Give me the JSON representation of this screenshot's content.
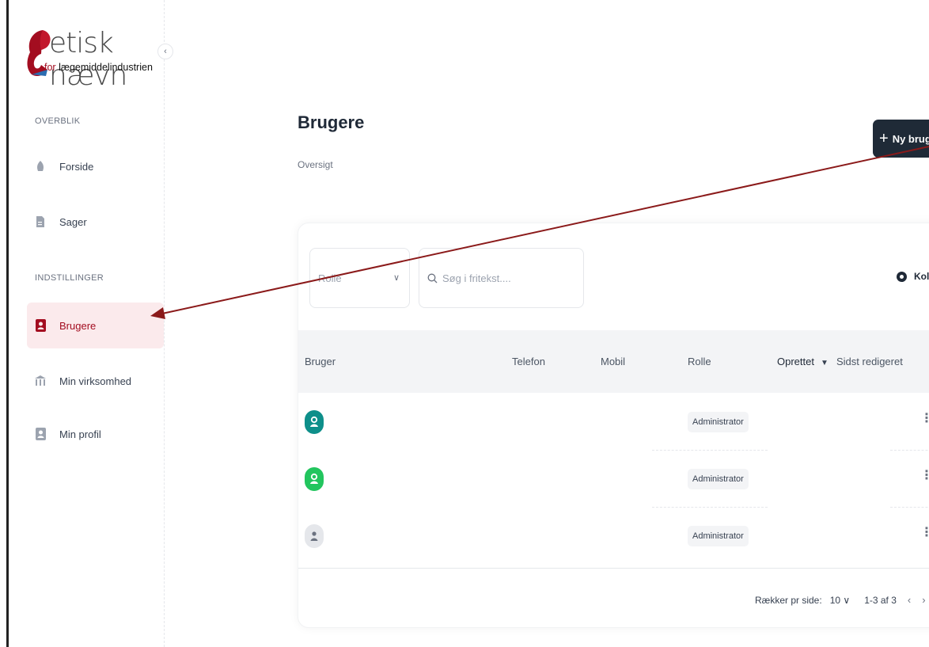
{
  "brand": {
    "name": "etisk nævn",
    "sub_accent": "for",
    "sub_text": "lægemiddelindustrien",
    "colors": {
      "primary": "#a30d20",
      "dark_button": "#1f2a37"
    }
  },
  "sidebar": {
    "sections": [
      {
        "label": "OVERBLIK"
      },
      {
        "label": "INDSTILLINGER"
      }
    ],
    "items": [
      {
        "label": "Forside",
        "icon": "gauge-icon"
      },
      {
        "label": "Sager",
        "icon": "document-icon"
      },
      {
        "label": "Brugere",
        "icon": "user-icon",
        "active": true
      },
      {
        "label": "Min virksomhed",
        "icon": "building-icon"
      },
      {
        "label": "Min profil",
        "icon": "profile-icon"
      }
    ]
  },
  "header": {
    "title": "Brugere",
    "subtitle": "Oversigt",
    "new_button_label": "Ny bruger"
  },
  "toolbar": {
    "role_filter_placeholder": "Rolle",
    "search_placeholder": "Søg i fritekst....",
    "columns_label": "Kolonner"
  },
  "table": {
    "columns": [
      "Bruger",
      "Telefon",
      "Mobil",
      "Rolle",
      "Oprettet",
      "Sidst redigeret"
    ],
    "sorted_column": "Oprettet",
    "rows": [
      {
        "role": "Administrator",
        "avatar_color": "#0e8f8a"
      },
      {
        "role": "Administrator",
        "avatar_color": "#22c55e"
      },
      {
        "role": "Administrator",
        "avatar_color": "#d1d5db"
      }
    ]
  },
  "pagination": {
    "rows_per_page_label": "Rækker pr side:",
    "rows_per_page_value": "10",
    "range": "1-3 af 3"
  }
}
